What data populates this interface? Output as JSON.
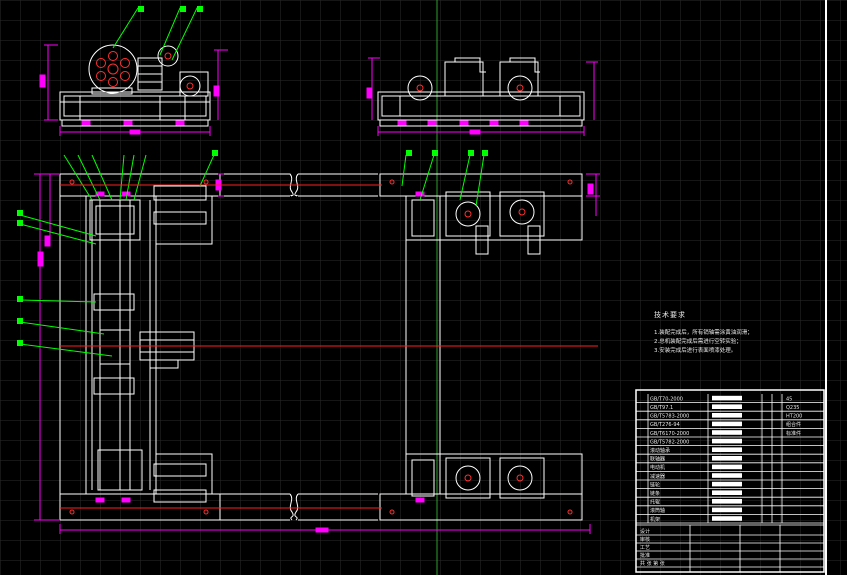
{
  "drawing": {
    "tech_requirements": {
      "title": "技术要求",
      "notes": [
        "1.装配完成后，所有销轴需涂黄油润滑；",
        "2.总机装配完成后需进行空转实验；",
        "3.安装完成后进行表面喷漆处理。"
      ]
    },
    "title_block": {
      "rows": [
        "GB/T70-2000",
        "GB/T97.1",
        "GB/T5783-2000",
        "GB/T276-94",
        "GB/T6170-2000",
        "GB/T5782-2000",
        "滚动轴承",
        "联轴器",
        "电动机",
        "减速器",
        "链轮",
        "链条",
        "托辊",
        "滚筒轴",
        "机架"
      ],
      "materials": [
        "45",
        "Q235",
        "HT200",
        "组合件",
        "标准件"
      ],
      "bottom_labels": [
        "设计",
        "审核",
        "工艺",
        "批准",
        "共 张 第 张"
      ]
    }
  },
  "colors": {
    "background": "#000000",
    "grid": "#2c2c2c",
    "outline": "#ffffff",
    "dimension": "#ff00ff",
    "leader": "#00ff00",
    "center": "#ff0000",
    "axis": "#2ea02e"
  }
}
